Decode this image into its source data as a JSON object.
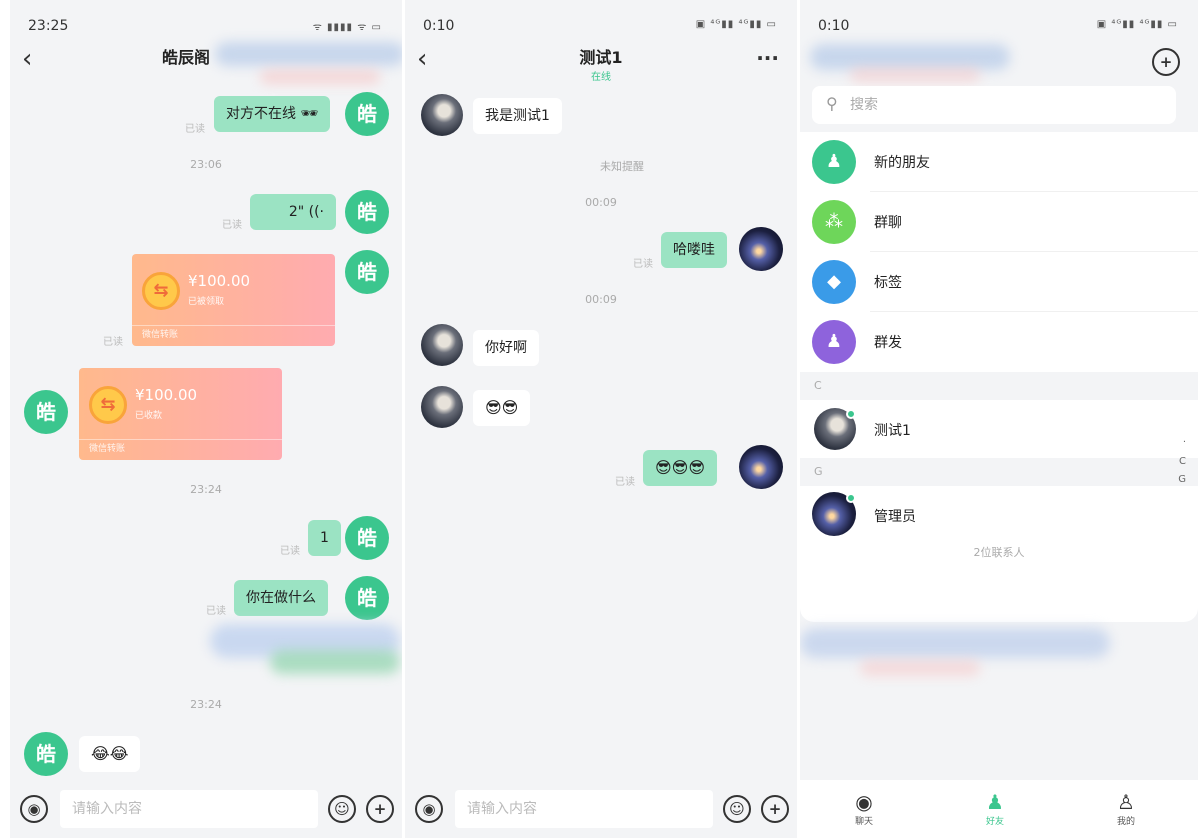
{
  "chat1": {
    "time": "23:25",
    "signal": "ᯤ ▮▮▮▮ ᯤ ▭",
    "title": "皓辰阁",
    "avatar_char": "皓",
    "msg_offline": "对方不在线 🕶",
    "read": "已读",
    "ts1": "23:06",
    "voice": "2\" ((·",
    "transfer_amount": "¥100.00",
    "transfer_state_1": "已被领取",
    "transfer_state_2": "已收款",
    "transfer_foot": "微信转账",
    "transfer_icon": "⇆",
    "ts2": "23:24",
    "msg_one": "1",
    "msg_doing": "你在做什么",
    "ts3": "23:24",
    "emoji_msg": "😂😂"
  },
  "chat2": {
    "time": "0:10",
    "signal": "▣ ⁴ᴳ▮▮ ⁴ᴳ▮▮ ▭",
    "title": "测试1",
    "subtitle": "在线",
    "more": "···",
    "msg_intro": "我是测试1",
    "unknown_tip": "未知提醒",
    "ts1": "00:09",
    "msg_wow": "哈喽哇",
    "read": "已读",
    "ts2": "00:09",
    "msg_hello": "你好啊",
    "emoji_other": "😎😎",
    "emoji_me": "😎😎😎"
  },
  "input": {
    "placeholder": "请输入内容",
    "voice_icon": "◉",
    "emoji_icon": "☺",
    "plus_icon": "+"
  },
  "contacts": {
    "time": "0:10",
    "signal": "▣ ⁴ᴳ▮▮ ⁴ᴳ▮▮ ▭",
    "add_icon": "+",
    "search_placeholder": "搜索",
    "search_icon": "⚲",
    "features": [
      {
        "label": "新的朋友",
        "icon": "♟",
        "color": "#3bc68e"
      },
      {
        "label": "群聊",
        "icon": "⁂",
        "color": "#6ed65a"
      },
      {
        "label": "标签",
        "icon": "◆",
        "color": "#3a9be8"
      },
      {
        "label": "群发",
        "icon": "♟",
        "color": "#8e63dc"
      }
    ],
    "group_c": "C",
    "contact_c": "测试1",
    "group_g": "G",
    "contact_g": "管理员",
    "count": "2位联系人",
    "index": [
      ".",
      "C",
      "G"
    ]
  },
  "tabs": [
    {
      "label": "聊天",
      "icon": "◉"
    },
    {
      "label": "好友",
      "icon": "♟"
    },
    {
      "label": "我的",
      "icon": "♙"
    }
  ]
}
